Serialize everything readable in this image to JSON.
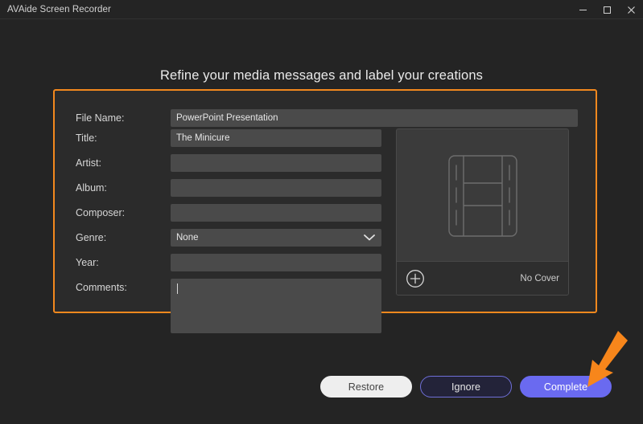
{
  "window": {
    "title": "AVAide Screen Recorder",
    "controls": [
      {
        "name": "minimize",
        "label": "Minimize"
      },
      {
        "name": "maximize",
        "label": "Maximize"
      },
      {
        "name": "close",
        "label": "Close"
      }
    ]
  },
  "heading": "Refine your media messages and label your creations",
  "form": {
    "fields": [
      {
        "label": "File Name:",
        "value": "PowerPoint Presentation",
        "type": "text"
      },
      {
        "label": "Title:",
        "value": "The Minicure",
        "type": "text"
      },
      {
        "label": "Artist:",
        "value": "",
        "type": "text"
      },
      {
        "label": "Album:",
        "value": "",
        "type": "text"
      },
      {
        "label": "Composer:",
        "value": "",
        "type": "text"
      },
      {
        "label": "Genre:",
        "value": "None",
        "type": "select"
      },
      {
        "label": "Year:",
        "value": "",
        "type": "text"
      },
      {
        "label": "Comments:",
        "value": "",
        "type": "textarea"
      }
    ]
  },
  "cover": {
    "placeholder_icon": "film-strip-icon",
    "add_icon": "plus-circle-icon",
    "status": "No Cover"
  },
  "buttons": {
    "restore": "Restore",
    "ignore": "Ignore",
    "complete": "Complete"
  },
  "annotation": {
    "arrow": "orange-arrow-pointing-to-complete"
  },
  "colors": {
    "accent_orange": "#f2881e",
    "accent_purple": "#6a6af0",
    "panel_bg": "#2b2b2b",
    "window_bg": "#242424",
    "input_bg": "#4a4a4a"
  }
}
